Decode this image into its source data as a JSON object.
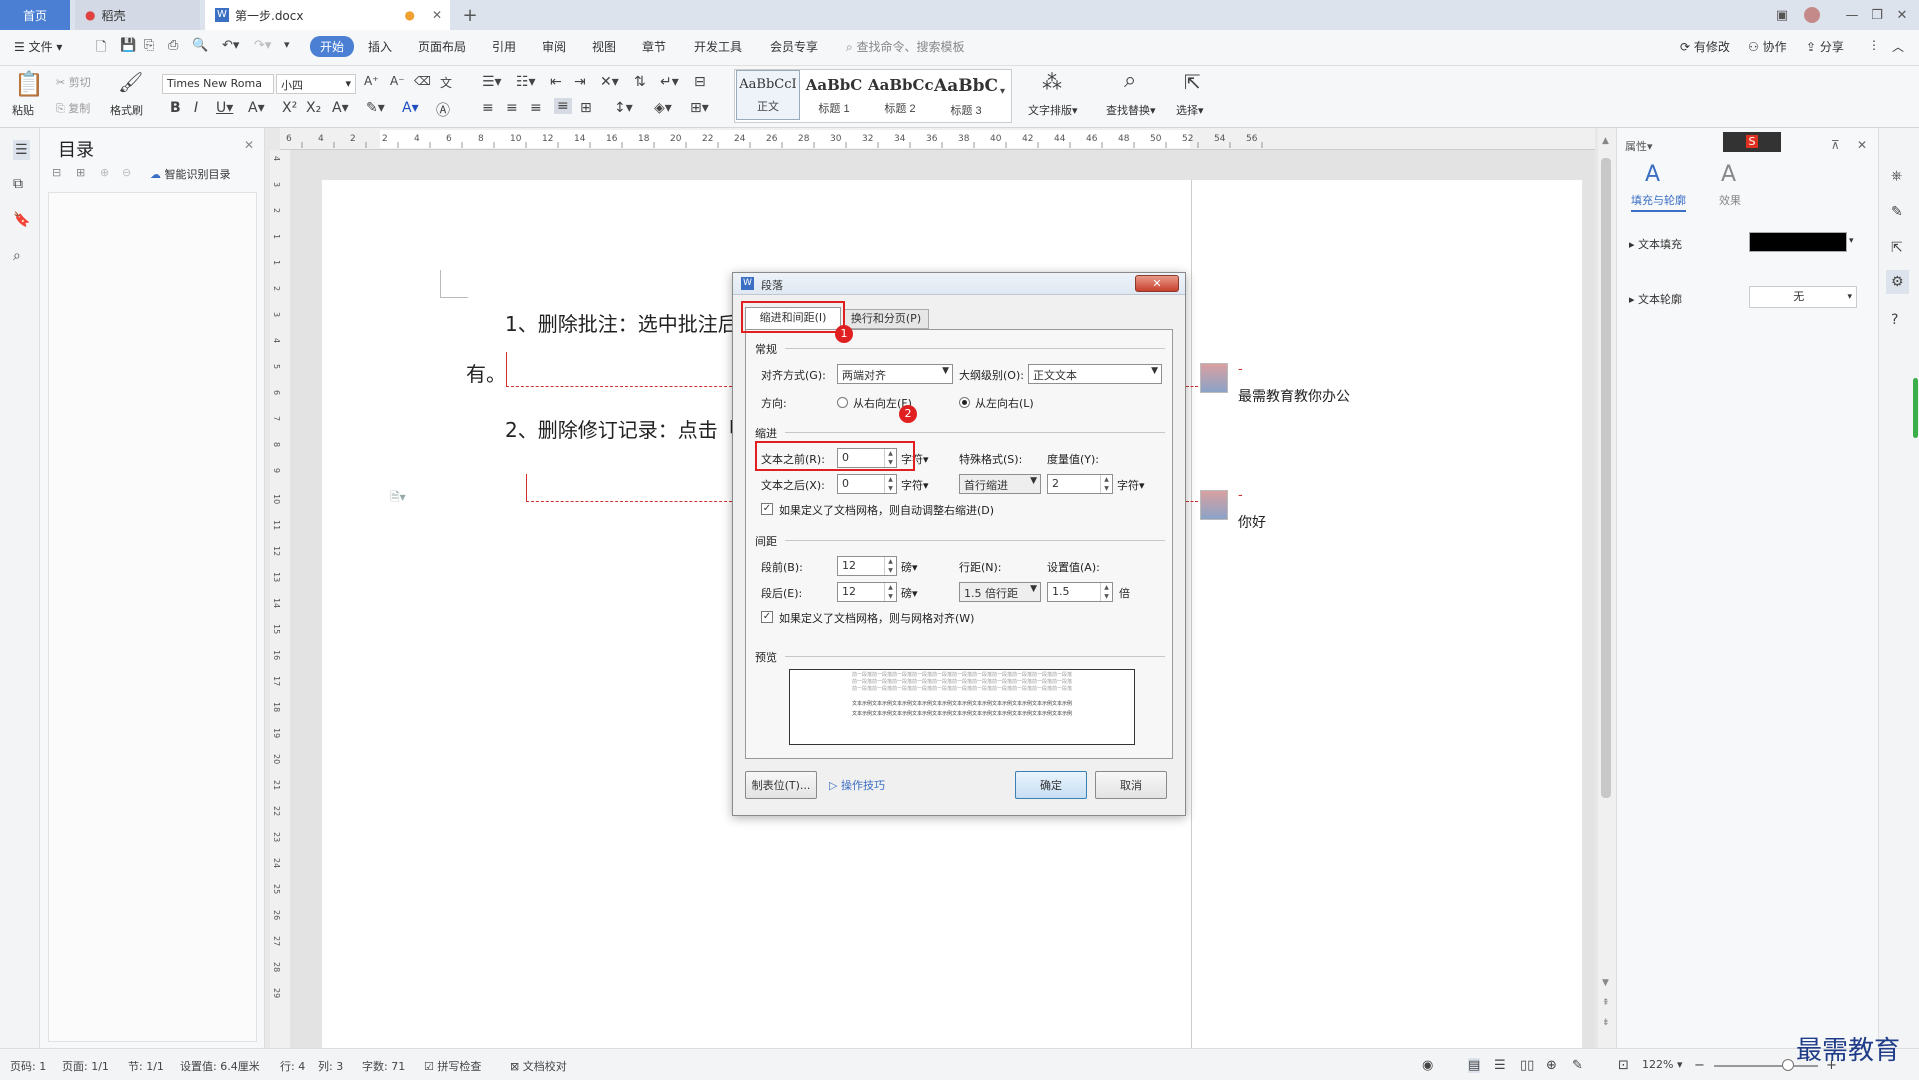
{
  "tabs": {
    "home": "首页",
    "daoke": "稻壳",
    "doc": "第一步.docx"
  },
  "menu": {
    "file": "文件",
    "items": [
      "开始",
      "插入",
      "页面布局",
      "引用",
      "审阅",
      "视图",
      "章节",
      "开发工具",
      "会员专享"
    ],
    "search": "查找命令、搜索模板",
    "right": [
      "有修改",
      "协作",
      "分享"
    ]
  },
  "ribbon": {
    "paste": "粘贴",
    "cut": "剪切",
    "copy": "复制",
    "format_painter": "格式刷",
    "font_name": "Times New Roma",
    "font_size": "小四",
    "styles": [
      {
        "sample": "AaBbCcI",
        "label": "正文"
      },
      {
        "sample": "AaBbC",
        "label": "标题 1"
      },
      {
        "sample": "AaBbCc",
        "label": "标题 2"
      },
      {
        "sample": "AaBbC",
        "label": "标题 3"
      }
    ],
    "text_layout": "文字排版",
    "find_replace": "查找替换",
    "select": "选择"
  },
  "toc": {
    "title": "目录",
    "smart": "智能识别目录"
  },
  "ruler_h": [
    "6",
    "4",
    "2",
    "2",
    "4",
    "6",
    "8",
    "10",
    "12",
    "14",
    "16",
    "18",
    "20",
    "22",
    "24",
    "26",
    "28",
    "30",
    "32",
    "34",
    "36",
    "38",
    "40",
    "42",
    "44",
    "46",
    "48",
    "50",
    "52",
    "54",
    "56"
  ],
  "ruler_v": [
    "4",
    "3",
    "2",
    "1",
    "1",
    "2",
    "3",
    "4",
    "5",
    "6",
    "7",
    "8",
    "9",
    "10",
    "11",
    "12",
    "13",
    "14",
    "15",
    "16",
    "17",
    "18",
    "19",
    "20",
    "21",
    "22",
    "23",
    "24",
    "25",
    "26",
    "27",
    "28",
    "29"
  ],
  "document": {
    "line1": "1、删除批注：选中批注后",
    "line2": "有。",
    "line3": "2、删除修订记录：点击「"
  },
  "comments": [
    {
      "name": "-",
      "text": "最需教育教你办公"
    },
    {
      "name": "-",
      "text": "你好"
    }
  ],
  "dialog": {
    "title": "段落",
    "tab1": "缩进和间距(I)",
    "tab2": "换行和分页(P)",
    "general": "常规",
    "align_label": "对齐方式(G):",
    "align_value": "两端对齐",
    "outline_label": "大纲级别(O):",
    "outline_value": "正文文本",
    "direction_label": "方向:",
    "rtl": "从右向左(F)",
    "ltr": "从左向右(L)",
    "indent": "缩进",
    "before_label": "文本之前(R):",
    "before_value": "0",
    "unit_char": "字符▾",
    "after_label": "文本之后(X):",
    "after_value": "0",
    "special_label": "特殊格式(S):",
    "special_value": "首行缩进",
    "measure_label": "度量值(Y):",
    "measure_value": "2",
    "grid_indent": "如果定义了文档网格，则自动调整右缩进(D)",
    "spacing": "间距",
    "space_before_label": "段前(B):",
    "space_before_value": "12",
    "unit_pt": "磅▾",
    "space_after_label": "段后(E):",
    "space_after_value": "12",
    "line_spacing_label": "行距(N):",
    "line_spacing_value": "1.5 倍行距",
    "set_value_label": "设置值(A):",
    "set_value": "1.5",
    "unit_times": "倍",
    "grid_snap": "如果定义了文档网格，则与网格对齐(W)",
    "preview": "预览",
    "preview_prev": "前一段落前一段落前一段落前一段落前一段落前一段落前一段落前一段落前一段落前一段落前一段落",
    "preview_cur": "文本示例文本示例文本示例文本示例文本示例文本示例文本示例文本示例文本示例文本示例文本示例",
    "tabs_btn": "制表位(T)...",
    "tips": "操作技巧",
    "ok": "确定",
    "cancel": "取消",
    "badge1": "1",
    "badge2": "2"
  },
  "right_panel": {
    "title": "属性",
    "fill_outline": "填充与轮廓",
    "effects": "效果",
    "text_fill": "文本填充",
    "text_outline": "文本轮廓",
    "outline_value": "无"
  },
  "status": {
    "page_num": "页码: 1",
    "pages": "页面: 1/1",
    "section": "节: 1/1",
    "setting": "设置值: 6.4厘米",
    "row": "行: 4",
    "col": "列: 3",
    "words": "字数: 71",
    "spell": "拼写检查",
    "proof": "文档校对",
    "zoom": "122%"
  },
  "watermark": "最需教育",
  "colors": {
    "accent": "#4a7fd4",
    "highlight": "#e02020"
  }
}
